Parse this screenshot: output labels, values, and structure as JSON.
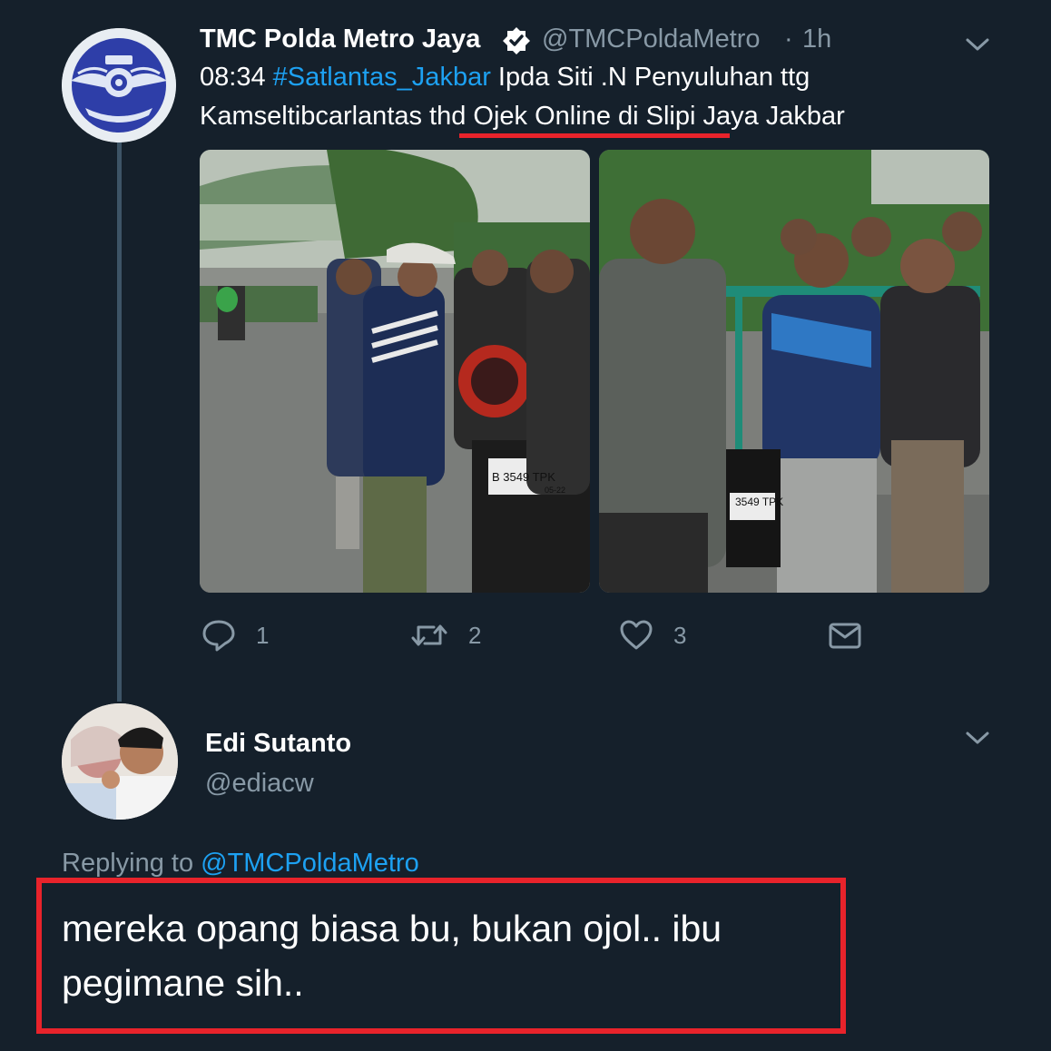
{
  "tweet": {
    "author_name": "TMC Polda Metro Jaya",
    "author_handle": "@TMCPoldaMetro",
    "time_separator": "·",
    "time": "1h",
    "text_prefix": "08:34 ",
    "hashtag": "#Satlantas_Jakbar",
    "text_rest": " Ipda Siti .N Penyuluhan ttg Kamseltibcarlantas thd Ojek Online di Slipi Jaya Jakbar",
    "plate_1": "B 3549 TPK",
    "plate_1_sub": "05-22",
    "plate_2": "3549 TPK",
    "actions": {
      "reply_count": "1",
      "retweet_count": "2",
      "like_count": "3"
    }
  },
  "reply": {
    "author_name": "Edi Sutanto",
    "author_handle": "@ediacw",
    "replying_label": "Replying to ",
    "replying_mention": "@TMCPoldaMetro",
    "text": "mereka opang biasa bu, bukan ojol.. ibu pegimane sih.."
  },
  "colors": {
    "background": "#15202b",
    "accent": "#1da1f2",
    "muted": "#8899a6",
    "highlight": "#e8232b"
  }
}
